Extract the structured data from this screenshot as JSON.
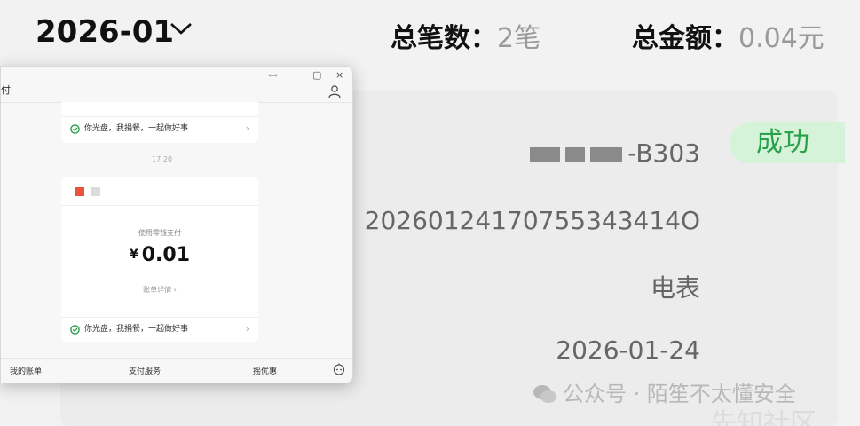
{
  "header": {
    "month": "2026-01",
    "total_count_label": "总笔数：",
    "total_count_value": "2笔",
    "total_amount_label": "总金额：",
    "total_amount_value": "0.04元"
  },
  "record": {
    "status": "成功",
    "name_suffix": "-B303",
    "order_no": "20260124170755343414O",
    "type": "电表",
    "date": "2026-01-24"
  },
  "watermark": {
    "text": "公众号 · 陌笙不太懂安全",
    "site": "先知社区"
  },
  "chat_window": {
    "title": "付",
    "controls": {
      "pin": "ꟷ",
      "minimize": "−",
      "maximize": "▢",
      "close": "×"
    },
    "msg1_link": "你光盘，我捐餐，一起做好事",
    "time": "17:20",
    "pay_label": "使用零钱支付",
    "currency": "¥",
    "amount": "0.01",
    "details_link": "账单详情 ›",
    "msg2_link": "你光盘，我捐餐，一起做好事",
    "tabs": [
      "我的账单",
      "支付服务",
      "摇优惠"
    ]
  },
  "colors": {
    "success_bg": "#d4f3d9",
    "success_text": "#2aa04a",
    "logo_red": "#e8533a"
  }
}
